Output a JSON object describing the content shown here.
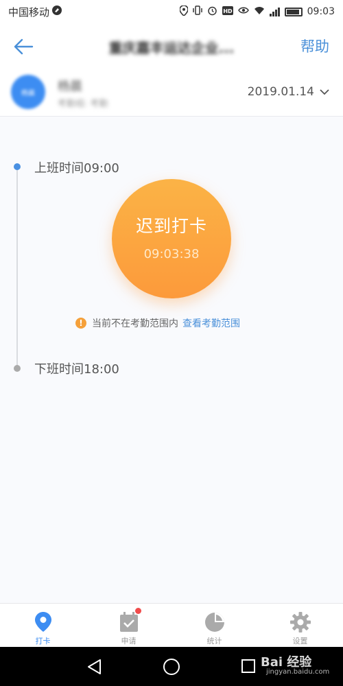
{
  "status_bar": {
    "carrier": "中国移动",
    "time": "09:03"
  },
  "header": {
    "title": "重庆嘉丰运达企业...",
    "help_label": "帮助"
  },
  "user": {
    "avatar_text": "杨晨",
    "name": "杨晨",
    "group": "考勤组: 考勤"
  },
  "date_selector": {
    "value": "2019.01.14"
  },
  "timeline": {
    "start_label": "上班时间09:00",
    "end_label": "下班时间18:00"
  },
  "punch": {
    "label": "迟到打卡",
    "time": "09:03:38"
  },
  "warning": {
    "text": "当前不在考勤范围内",
    "link": "查看考勤范围"
  },
  "tabs": [
    {
      "label": "打卡",
      "icon": "location-pin-icon",
      "active": true
    },
    {
      "label": "申请",
      "icon": "calendar-check-icon",
      "active": false
    },
    {
      "label": "统计",
      "icon": "pie-chart-icon",
      "active": false
    },
    {
      "label": "设置",
      "icon": "gear-icon",
      "active": false
    }
  ],
  "watermark": {
    "main": "Bai 经验",
    "sub": "jingyan.baidu.com"
  },
  "colors": {
    "accent": "#3d8df2",
    "punch_orange": "#fc9a3b",
    "badge_red": "#f04b4b"
  }
}
